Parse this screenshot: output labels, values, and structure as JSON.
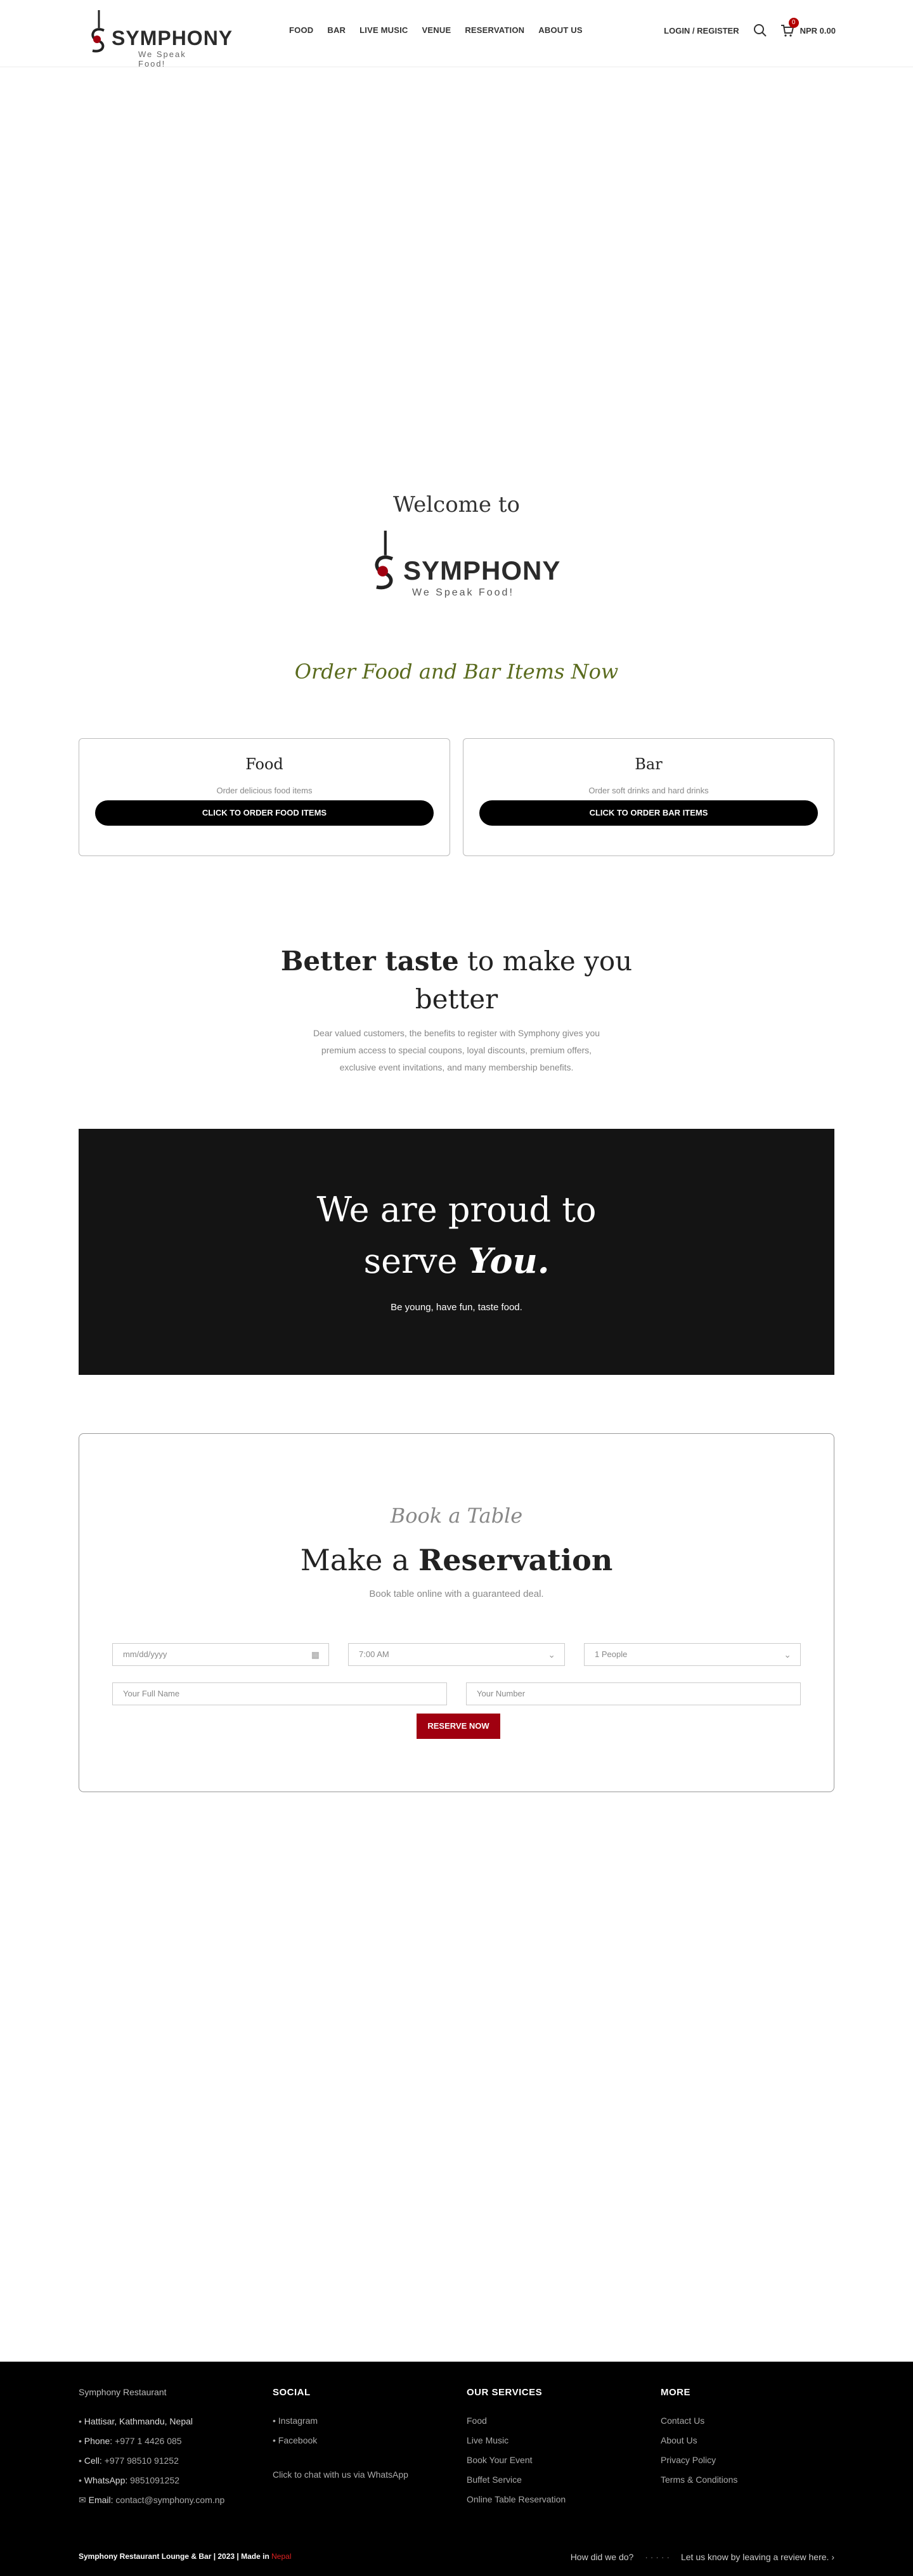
{
  "header": {
    "logo_word": "SYMPHONY",
    "logo_tag": "We Speak Food!",
    "nav": [
      "FOOD",
      "BAR",
      "LIVE MUSIC",
      "VENUE",
      "RESERVATION",
      "ABOUT US"
    ],
    "login": "LOGIN / REGISTER",
    "cart_count": "0",
    "cart_total": "NPR 0.00"
  },
  "welcome": {
    "title": "Welcome to",
    "logo_word": "SYMPHONY",
    "logo_tag": "We Speak Food!"
  },
  "order": {
    "title": "Order Food and Bar Items Now",
    "cards": [
      {
        "title": "Food",
        "desc": "Order delicious food items",
        "button": "CLICK TO ORDER FOOD ITEMS"
      },
      {
        "title": "Bar",
        "desc": "Order soft drinks and hard drinks",
        "button": "CLICK TO ORDER BAR ITEMS"
      }
    ]
  },
  "better": {
    "bold": "Better taste",
    "rest": " to make you better",
    "desc": "Dear valued customers, the benefits to register with Symphony gives you premium access to special coupons, loyal discounts, premium offers, exclusive event invitations, and many membership benefits."
  },
  "proud": {
    "line1": "We are proud to",
    "line2a": "serve ",
    "line2b": "You.",
    "sub": "Be young, have fun, taste food."
  },
  "reservation": {
    "kicker": "Book a Table",
    "title_a": "Make a ",
    "title_b": "Reservation",
    "sub": "Book table online with a guaranteed deal.",
    "date_placeholder": "mm/dd/yyyy",
    "time_value": "7:00 AM",
    "people_value": "1 People",
    "name_placeholder": "Your Full Name",
    "number_placeholder": "Your Number",
    "button": "RESERVE NOW"
  },
  "footer": {
    "logo_alt": "Symphony Restaurant",
    "contact": [
      {
        "label": "",
        "value": "Hattisar, Kathmandu, Nepal"
      },
      {
        "label": "Phone: ",
        "value": "+977 1 4426 085"
      },
      {
        "label": "Cell: ",
        "value": "+977 98510 91252"
      },
      {
        "label": "WhatsApp: ",
        "value": "9851091252"
      },
      {
        "label": "Email: ",
        "value": "contact@symphony.com.np"
      }
    ],
    "social_title": "SOCIAL",
    "social": [
      "Instagram",
      "Facebook"
    ],
    "whatsapp_alt": "Click to chat with us via WhatsApp",
    "services_title": "OUR SERVICES",
    "services": [
      "Food",
      "Live Music",
      "Book Your Event",
      "Buffet Service",
      "Online Table Reservation"
    ],
    "more_title": "MORE",
    "more": [
      "Contact Us",
      "About Us",
      "Privacy Policy",
      "Terms & Conditions"
    ],
    "copyright": "Symphony Restaurant Lounge & Bar | 2023 | Made in ",
    "copyright_red": "Nepal",
    "review_q": "How did we do?",
    "review_cta": "Let us know by leaving a review here."
  },
  "colors": {
    "accent": "#a00010",
    "order_title": "#5a6b1e",
    "dark_band": "#141414"
  }
}
